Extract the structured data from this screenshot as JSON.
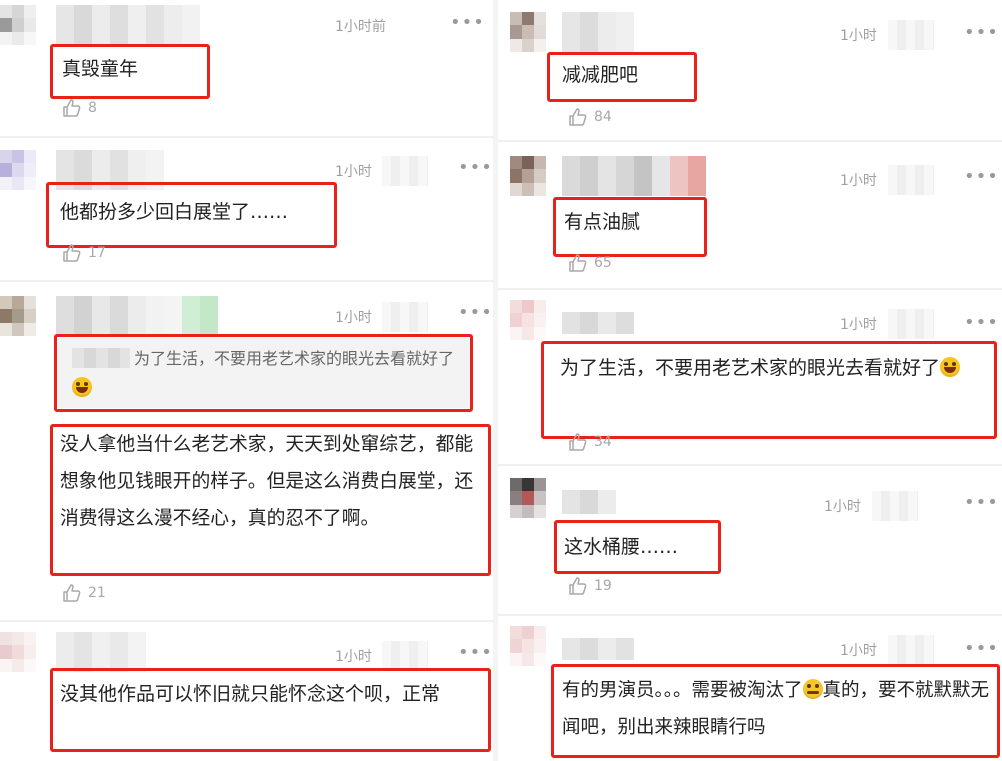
{
  "left": [
    {
      "time": "1小时前",
      "text": "真毁童年",
      "likes": "8"
    },
    {
      "time": "1小时",
      "text": "他都扮多少回白展堂了……",
      "likes": "17"
    },
    {
      "time": "1小时",
      "quote_text": "为了生活，不要用老艺术家的眼光去看就好了",
      "text": "没人拿他当什么老艺术家，天天到处窜综艺，都能想象他见钱眼开的样子。但是这么消费白展堂，还消费得这么漫不经心，真的忍不了啊。",
      "likes": "21"
    },
    {
      "time": "1小时",
      "text": "没其他作品可以怀旧就只能怀念这个呗，正常"
    }
  ],
  "right": [
    {
      "time": "1小时",
      "text": "减减肥吧",
      "likes": "84"
    },
    {
      "time": "1小时",
      "text": "有点油腻",
      "likes": "65"
    },
    {
      "time": "1小时",
      "text": "为了生活，不要用老艺术家的眼光去看就好了",
      "likes": "34"
    },
    {
      "time": "1小时",
      "text": "这水桶腰……",
      "likes": "19"
    },
    {
      "time": "1小时",
      "text": "有的男演员。。。需要被淘汰了",
      "text_after_emoji": "真的，要不就默默无闻吧，别出来辣眼睛行吗"
    }
  ],
  "more_label": "•••",
  "icons": {
    "like": "thumbs-up-icon",
    "more": "more-dots-icon",
    "emoji_grin": "grinning-face-icon",
    "emoji_sweat": "sweat-face-icon"
  },
  "colors": {
    "highlight_box": "#e8221a",
    "meta_text": "#a0a0a0",
    "body_text": "#222222"
  }
}
